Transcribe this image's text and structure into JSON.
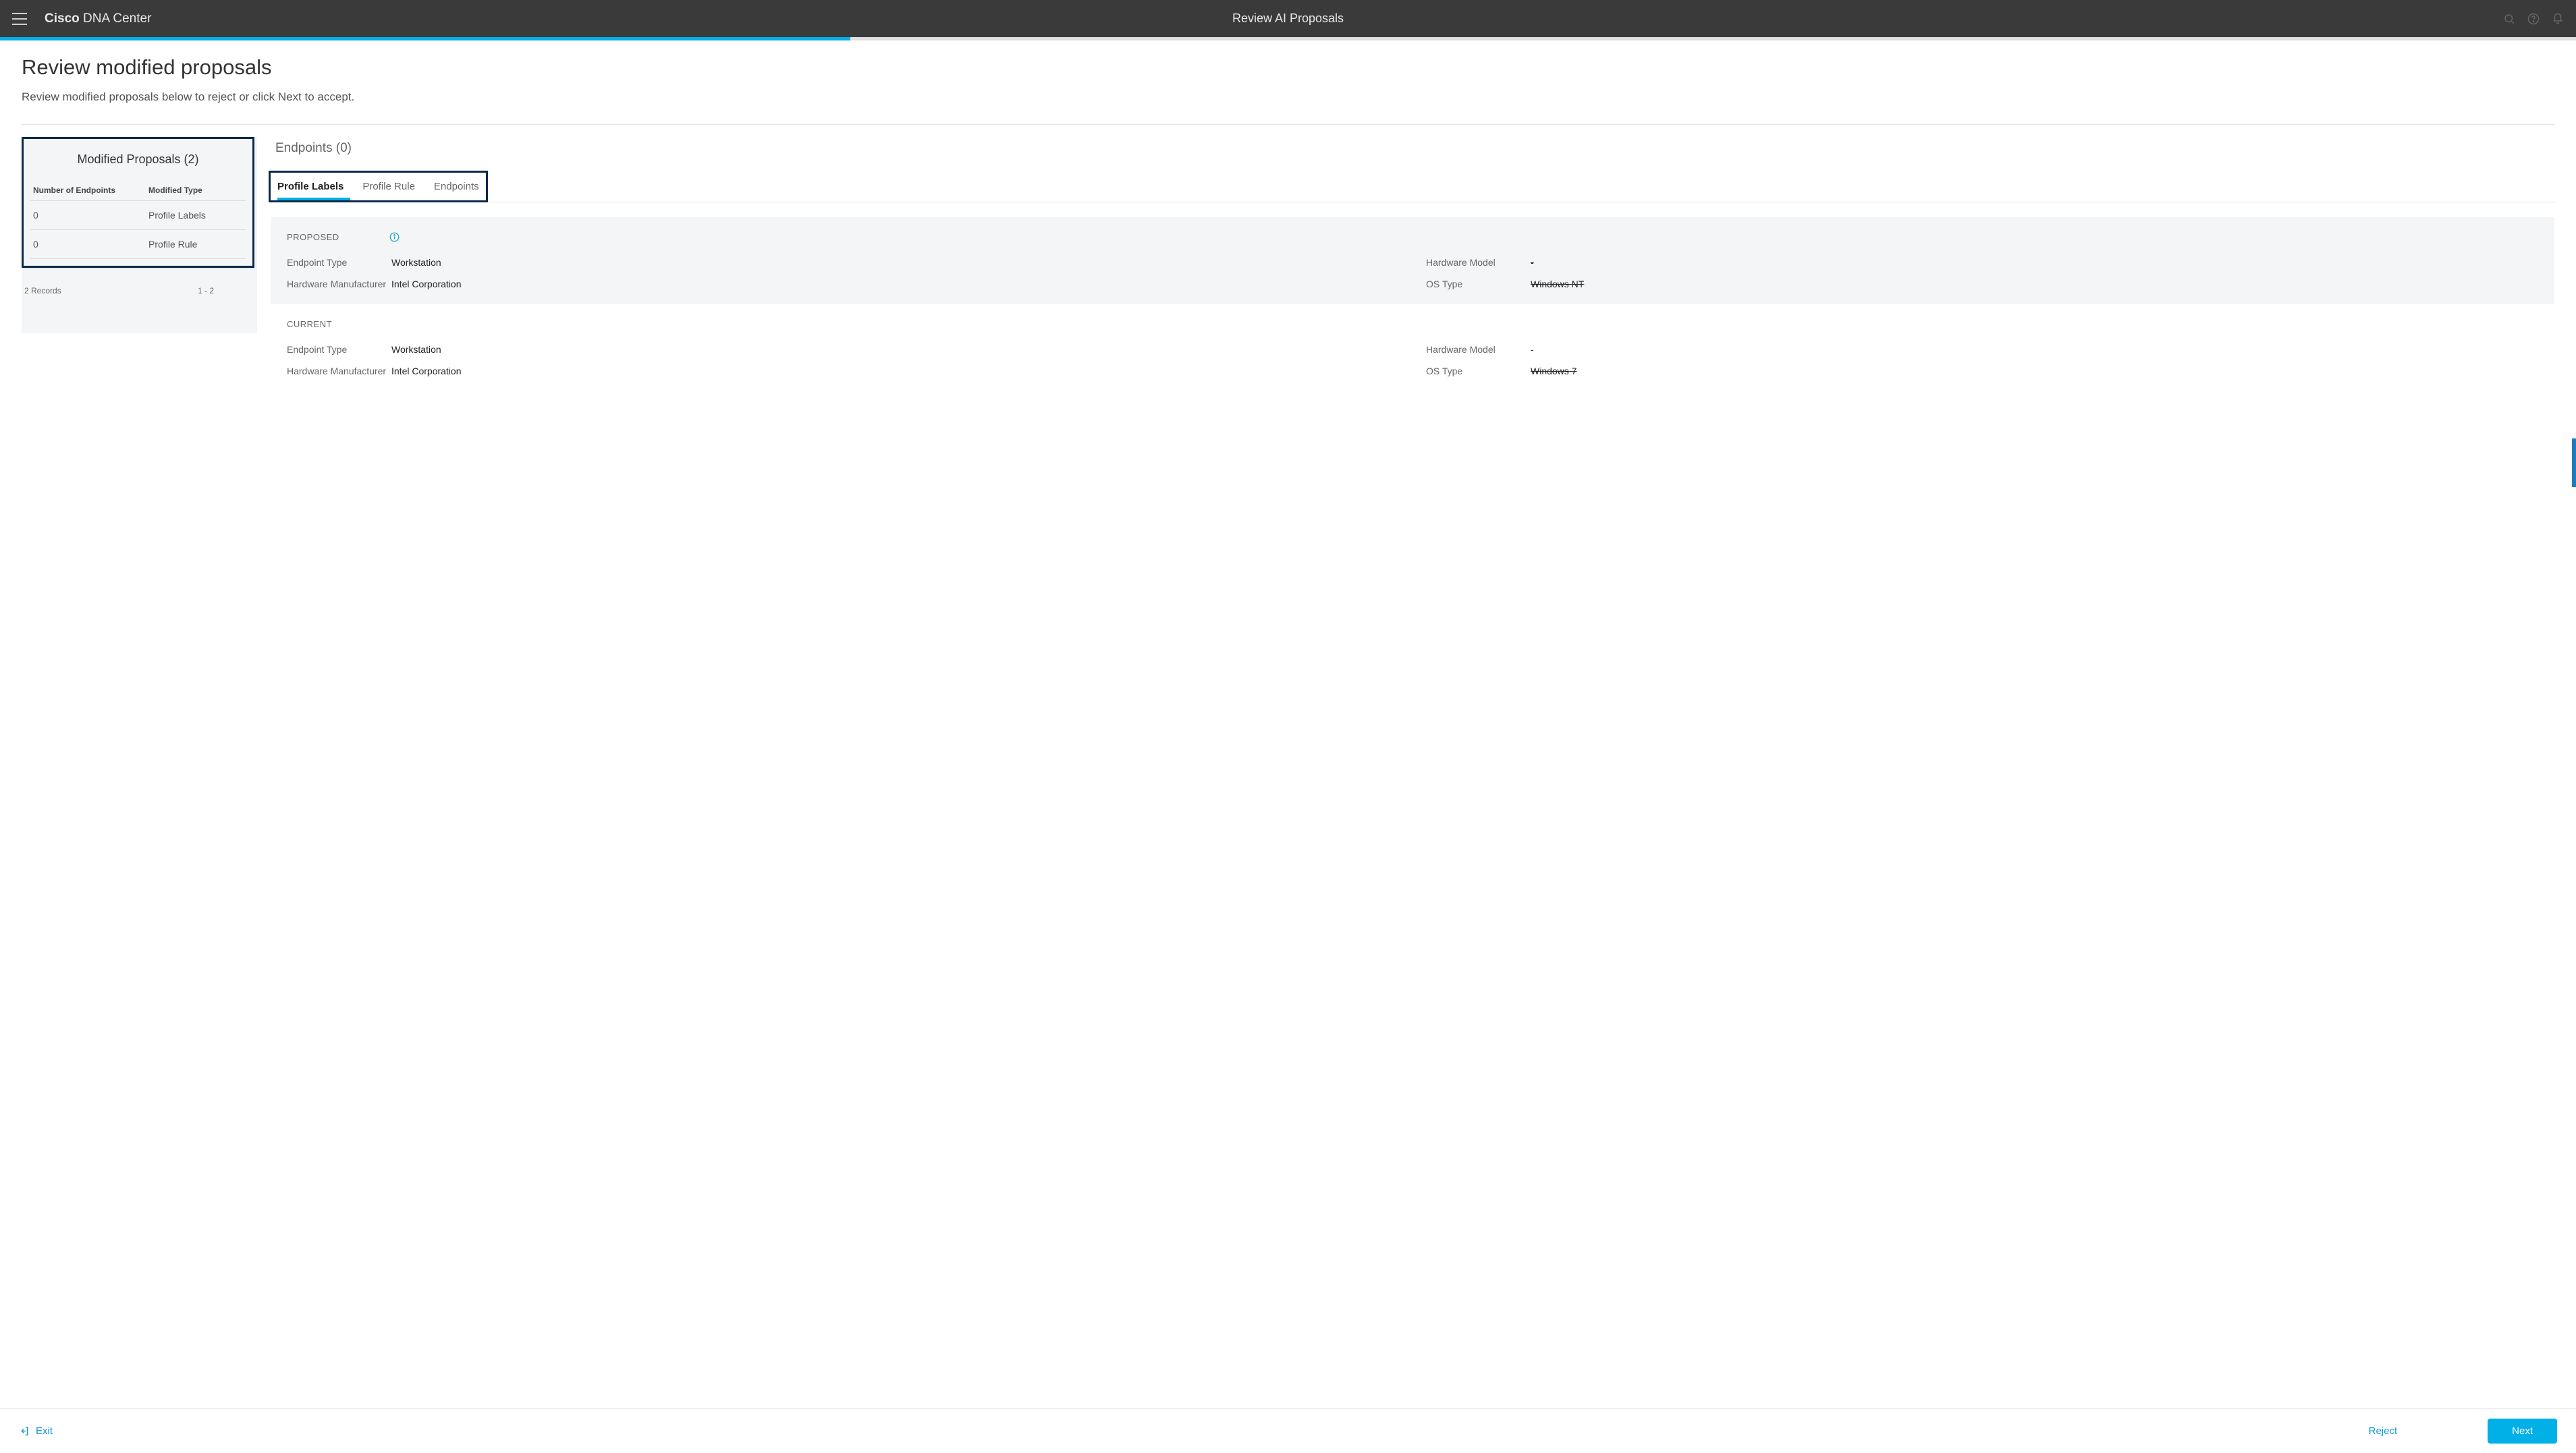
{
  "topbar": {
    "brand_bold": "Cisco",
    "brand_light": " DNA Center",
    "title": "Review AI Proposals"
  },
  "page": {
    "title": "Review modified proposals",
    "subtext": "Review modified proposals below to reject or click Next to accept."
  },
  "sidepanel": {
    "title": "Modified Proposals (2)",
    "header_num": "Number of Endpoints",
    "header_type": "Modified Type",
    "rows": [
      {
        "num": "0",
        "type": "Profile Labels"
      },
      {
        "num": "0",
        "type": "Profile Rule"
      }
    ],
    "records": "2 Records",
    "range": "1 - 2"
  },
  "main": {
    "heading": "Endpoints (0)",
    "tabs": [
      {
        "label": "Profile Labels",
        "active": true
      },
      {
        "label": "Profile Rule",
        "active": false
      },
      {
        "label": "Endpoints",
        "active": false
      }
    ]
  },
  "proposed": {
    "title": "PROPOSED",
    "endpoint_type_k": "Endpoint Type",
    "endpoint_type_v": "Workstation",
    "hw_model_k": "Hardware Model",
    "hw_model_v": "-",
    "hw_mfr_k": "Hardware Manufacturer",
    "hw_mfr_v": "Intel Corporation",
    "os_type_k": "OS Type",
    "os_type_v": "Windows NT"
  },
  "current": {
    "title": "CURRENT",
    "endpoint_type_k": "Endpoint Type",
    "endpoint_type_v": "Workstation",
    "hw_model_k": "Hardware Model",
    "hw_model_v": "-",
    "hw_mfr_k": "Hardware Manufacturer",
    "hw_mfr_v": "Intel Corporation",
    "os_type_k": "OS Type",
    "os_type_v": "Windows 7"
  },
  "footer": {
    "exit": "Exit",
    "reject": "Reject",
    "next": "Next"
  }
}
